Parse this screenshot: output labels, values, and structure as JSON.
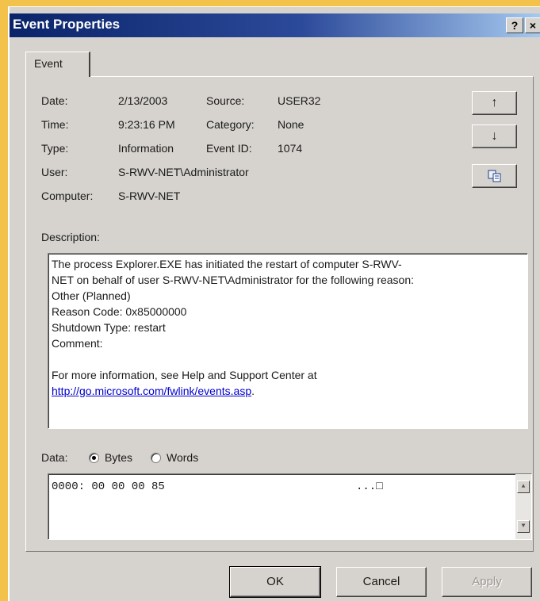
{
  "window": {
    "title": "Event Properties",
    "help_button": "?",
    "close_button": "×"
  },
  "tabs": [
    {
      "label": "Event",
      "selected": true
    }
  ],
  "event": {
    "date_label": "Date:",
    "date_value": "2/13/2003",
    "source_label": "Source:",
    "source_value": "USER32",
    "time_label": "Time:",
    "time_value": "9:23:16 PM",
    "category_label": "Category:",
    "category_value": "None",
    "type_label": "Type:",
    "type_value": "Information",
    "event_id_label": "Event ID:",
    "event_id_value": "1074",
    "user_label": "User:",
    "user_value": "S-RWV-NET\\Administrator",
    "computer_label": "Computer:",
    "computer_value": "S-RWV-NET"
  },
  "side_buttons": {
    "up": "↑",
    "down": "↓",
    "copy_icon": "copy-icon"
  },
  "description": {
    "label": "Description:",
    "lines": [
      "The process Explorer.EXE has initiated the restart of computer S-RWV-",
      "NET on behalf of user S-RWV-NET\\Administrator for the following reason:",
      "Other (Planned)",
      " Reason Code: 0x85000000",
      " Shutdown Type: restart",
      " Comment:",
      "",
      "For more information, see Help and Support Center at"
    ],
    "link": "http://go.microsoft.com/fwlink/events.asp",
    "link_suffix": "."
  },
  "data": {
    "label": "Data:",
    "bytes_label": "Bytes",
    "words_label": "Words",
    "selected": "Bytes",
    "row_hex": "0000: 00 00 00 85",
    "row_ascii": "...□"
  },
  "buttons": {
    "ok": "OK",
    "cancel": "Cancel",
    "apply": "Apply"
  },
  "colors": {
    "desktop": "#f3c24a",
    "dialog": "#d6d3ce",
    "title_start": "#0a246a",
    "link": "#0000cc"
  }
}
